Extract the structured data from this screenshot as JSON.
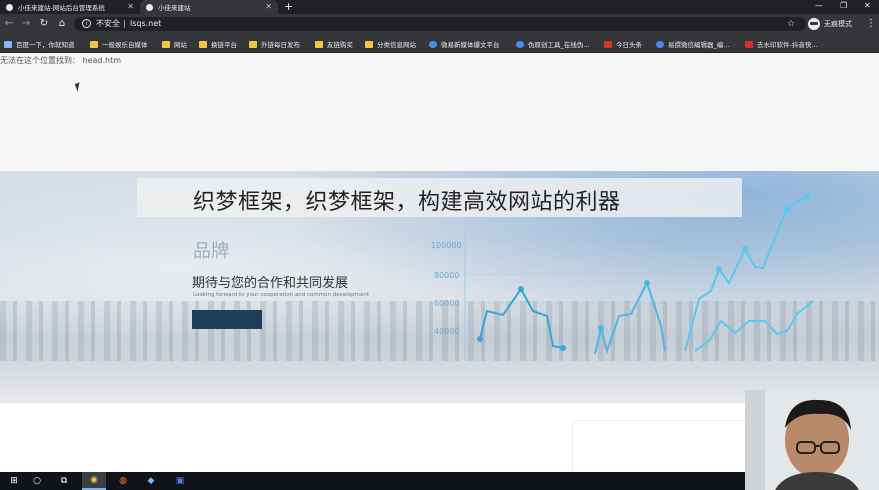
{
  "browser": {
    "tabs": [
      {
        "title": "小佳来建站-网站后台管理系统"
      },
      {
        "title": "小佳来建站"
      }
    ],
    "new_tab": "+",
    "window_controls": {
      "minimize": "—",
      "maximize": "❐",
      "close": "✕"
    },
    "security_label": "不安全",
    "url": "lsqs.net",
    "profile_label": "无痕模式",
    "bookmarks": [
      {
        "label": "百度一下，你就知道",
        "icon": "paw-icon"
      },
      {
        "label": "一极娱乐自媒体",
        "icon": "folder-icon"
      },
      {
        "label": "网站",
        "icon": "folder-icon"
      },
      {
        "label": "换链平台",
        "icon": "folder-icon"
      },
      {
        "label": "外链每日发布",
        "icon": "folder-icon"
      },
      {
        "label": "友链购买",
        "icon": "folder-icon"
      },
      {
        "label": "分类信息网站",
        "icon": "folder-icon"
      },
      {
        "label": "微易新媒体爆文平台",
        "icon": "globe-icon"
      },
      {
        "label": "伪原创工具_在线伪...",
        "icon": "globe-icon"
      },
      {
        "label": "今日头条",
        "icon": "toutiao-icon"
      },
      {
        "label": "易撰微信编辑器_编...",
        "icon": "pin-icon"
      },
      {
        "label": "去水印软件-抖音快...",
        "icon": "red-icon"
      }
    ]
  },
  "page": {
    "error_text": "无法在这个位置找到： head.htm",
    "banner": {
      "title_fragment": "品牌",
      "subtitle": "期待与您的合作和共同发展",
      "subtitle_small": "Looking forward to your cooperation and common development",
      "y_ticks": [
        "100000",
        "80000",
        "60000",
        "40000"
      ]
    },
    "overlay_title": "织梦框架，织梦框架，构建高效网站的利器"
  },
  "taskbar": {
    "items": [
      {
        "name": "start-icon",
        "glyph": "⊞"
      },
      {
        "name": "search-icon",
        "glyph": "○"
      },
      {
        "name": "task-view-icon",
        "glyph": "⧉"
      },
      {
        "name": "chrome-icon",
        "glyph": "◉"
      },
      {
        "name": "firefox-icon",
        "glyph": "◍"
      },
      {
        "name": "app-icon",
        "glyph": "◆"
      },
      {
        "name": "app2-icon",
        "glyph": "▣"
      }
    ]
  },
  "colors": {
    "chart_line": "#3aa7dc",
    "chart_accent": "#5bc8f2",
    "banner_button": "#1d3f5c"
  }
}
